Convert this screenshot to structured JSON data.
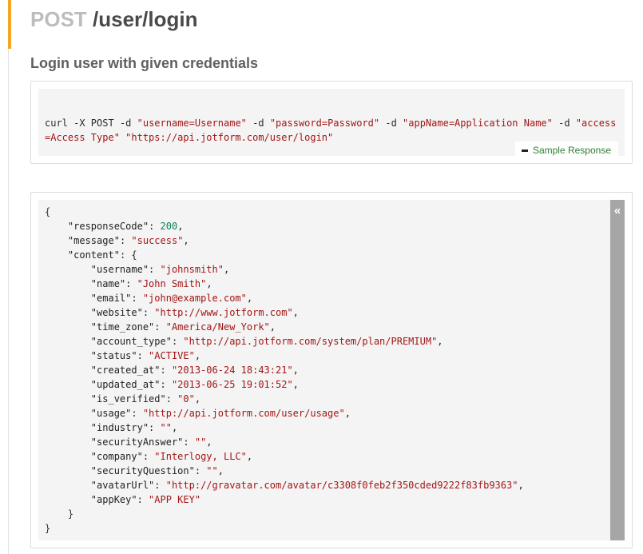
{
  "endpoint": {
    "method": "POST",
    "path": "/user/login"
  },
  "description": "Login user with given credentials",
  "curl": {
    "prefix": "curl -X POST",
    "flag": "-d",
    "params": [
      "\"username=Username\"",
      "\"password=Password\"",
      "\"appName=Application Name\"",
      "\"access=Access Type\""
    ],
    "url": "\"https://api.jotform.com/user/login\""
  },
  "sample_button": {
    "label": "Sample Response",
    "icon": "minus-icon"
  },
  "scrollbar": {
    "icon": "double-chevron-left-icon",
    "glyph": "«"
  },
  "response": {
    "open_brace": "{",
    "close_brace": "}",
    "responseCode": {
      "key": "\"responseCode\"",
      "value": "200"
    },
    "message": {
      "key": "\"message\"",
      "value": "\"success\""
    },
    "content_key": "\"content\"",
    "content_close": "}",
    "content": [
      {
        "key": "\"username\"",
        "value": "\"johnsmith\""
      },
      {
        "key": "\"name\"",
        "value": "\"John Smith\""
      },
      {
        "key": "\"email\"",
        "value": "\"john@example.com\""
      },
      {
        "key": "\"website\"",
        "value": "\"http://www.jotform.com\""
      },
      {
        "key": "\"time_zone\"",
        "value": "\"America/New_York\""
      },
      {
        "key": "\"account_type\"",
        "value": "\"http://api.jotform.com/system/plan/PREMIUM\""
      },
      {
        "key": "\"status\"",
        "value": "\"ACTIVE\""
      },
      {
        "key": "\"created_at\"",
        "value": "\"2013-06-24 18:43:21\""
      },
      {
        "key": "\"updated_at\"",
        "value": "\"2013-06-25 19:01:52\""
      },
      {
        "key": "\"is_verified\"",
        "value": "\"0\""
      },
      {
        "key": "\"usage\"",
        "value": "\"http://api.jotform.com/user/usage\""
      },
      {
        "key": "\"industry\"",
        "value": "\"\""
      },
      {
        "key": "\"securityAnswer\"",
        "value": "\"\""
      },
      {
        "key": "\"company\"",
        "value": "\"Interlogy, LLC\""
      },
      {
        "key": "\"securityQuestion\"",
        "value": "\"\""
      },
      {
        "key": "\"avatarUrl\"",
        "value": "\"http://gravatar.com/avatar/c3308f0feb2f350cded9222f83fb9363\""
      },
      {
        "key": "\"appKey\"",
        "value": "\"APP KEY\""
      }
    ]
  }
}
